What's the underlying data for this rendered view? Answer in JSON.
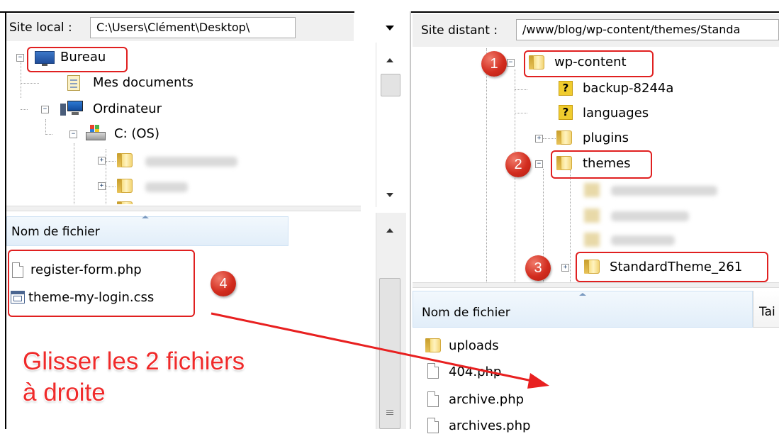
{
  "left": {
    "site_label": "Site local :",
    "path_value": "C:\\Users\\Clément\\Desktop\\",
    "tree": {
      "bureau": "Bureau",
      "mes_documents": "Mes documents",
      "ordinateur": "Ordinateur",
      "c_drive": "C: (OS)"
    },
    "list_header": "Nom de fichier",
    "files": [
      "register-form.php",
      "theme-my-login.css"
    ]
  },
  "right": {
    "site_label": "Site distant :",
    "path_value": "/www/blog/wp-content/themes/Standa",
    "tree": {
      "wp_content": "wp-content",
      "backup": "backup-8244a",
      "languages": "languages",
      "plugins": "plugins",
      "themes": "themes",
      "standard_theme": "StandardTheme_261"
    },
    "list_header": "Nom de fichier",
    "list_header_2": "Tai",
    "files": [
      "uploads",
      "404.php",
      "archive.php",
      "archives.php"
    ]
  },
  "annotations": {
    "badges": [
      "1",
      "2",
      "3",
      "4"
    ],
    "instruction_line1": "Glisser les 2 fichiers",
    "instruction_line2": "à droite",
    "accent_color": "#e02020"
  },
  "icons": [
    "monitor-icon",
    "document-icon",
    "computer-icon",
    "drive-icon",
    "folder-icon",
    "unknown-icon",
    "file-icon",
    "css-file-icon",
    "chevron-down-icon",
    "chevron-up-icon"
  ]
}
